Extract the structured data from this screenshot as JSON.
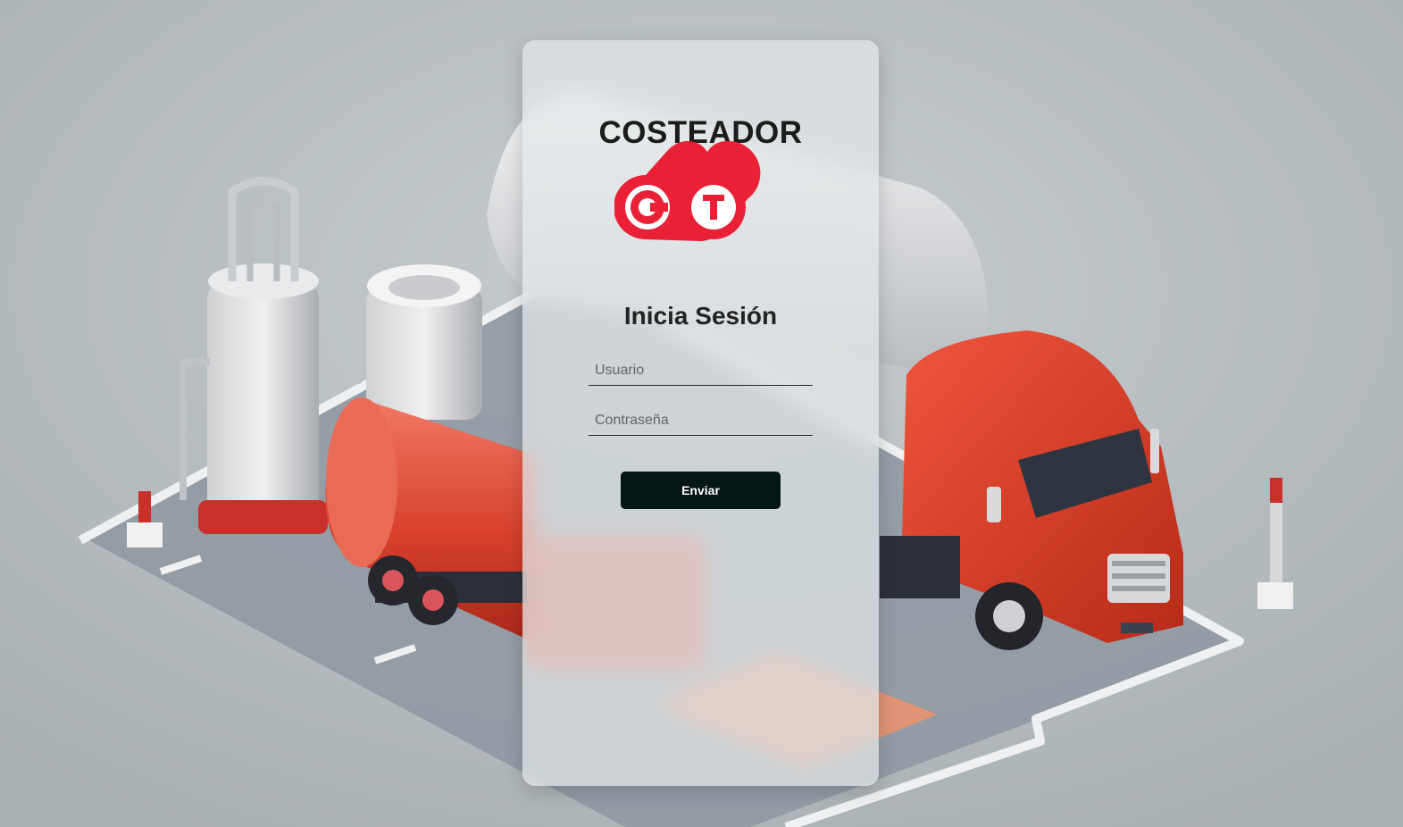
{
  "app_title": "COSTEADOR",
  "logo": {
    "letters": [
      "C",
      "T"
    ],
    "color": "#ea2136"
  },
  "form": {
    "heading": "Inicia Sesión",
    "username_placeholder": "Usuario",
    "password_placeholder": "Contraseña",
    "submit_label": "Enviar"
  },
  "colors": {
    "background": "#b9bfc1",
    "button": "#061516",
    "accent_red": "#ea2136"
  }
}
